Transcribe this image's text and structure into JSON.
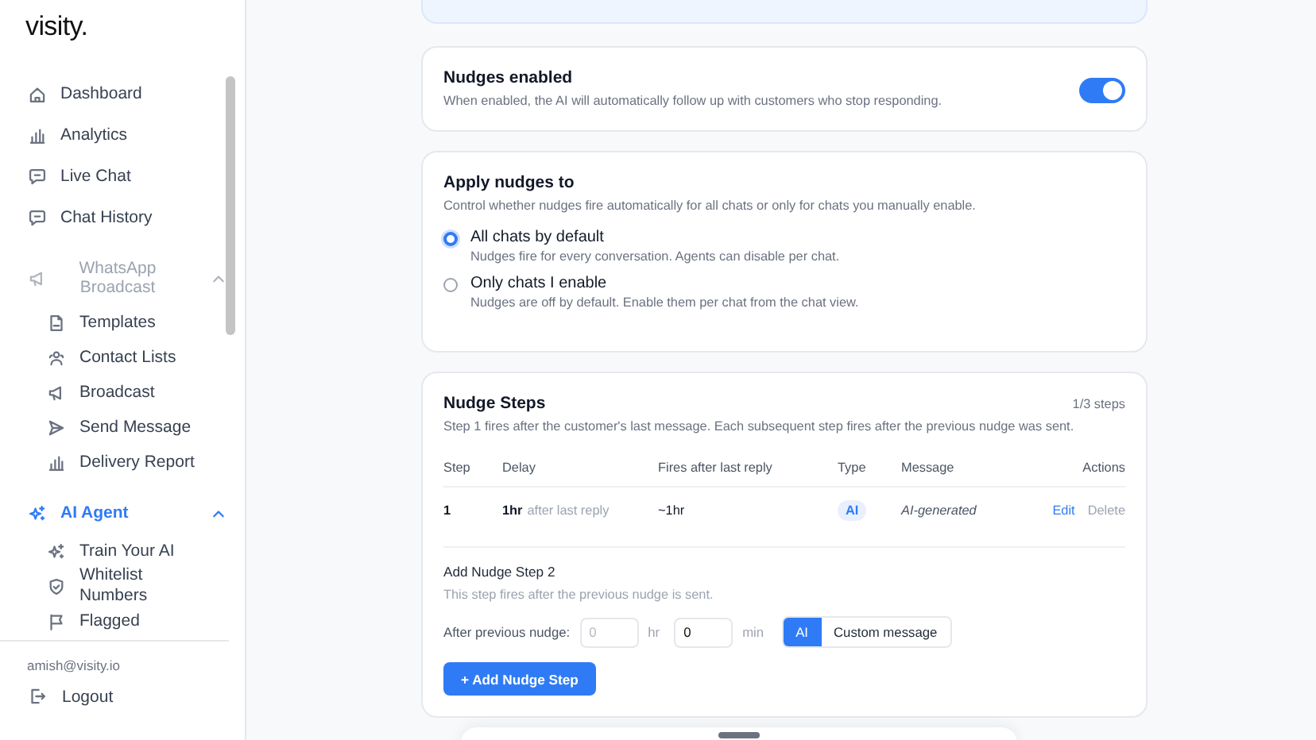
{
  "sidebar": {
    "logo": "visity.",
    "items": [
      {
        "label": "Dashboard",
        "kind": "link",
        "selected": false
      },
      {
        "label": "Analytics",
        "kind": "link",
        "selected": false
      },
      {
        "label": "Live Chat",
        "kind": "link",
        "selected": false
      },
      {
        "label": "Chat History",
        "kind": "link",
        "selected": false
      },
      {
        "label": "WhatsApp Broadcast",
        "kind": "group",
        "selected": false,
        "disabled": true,
        "expanded": true,
        "children": [
          {
            "label": "Templates"
          },
          {
            "label": "Contact Lists"
          },
          {
            "label": "Broadcast"
          },
          {
            "label": "Send Message"
          },
          {
            "label": "Delivery Report"
          }
        ]
      },
      {
        "label": "AI Agent",
        "kind": "group",
        "selected": true,
        "disabled": false,
        "expanded": true,
        "children": [
          {
            "label": "Train Your AI"
          },
          {
            "label": "Whitelist Numbers"
          },
          {
            "label": "Flagged"
          }
        ]
      }
    ],
    "user_email": "amish@visity.io",
    "logout": "Logout"
  },
  "nudges_enabled": {
    "title": "Nudges enabled",
    "description": "When enabled, the AI will automatically follow up with customers who stop responding.",
    "on": true
  },
  "apply_to": {
    "title": "Apply nudges to",
    "description": "Control whether nudges fire automatically for all chats or only for chats you manually enable.",
    "options": [
      {
        "label": "All chats by default",
        "description": "Nudges fire for every conversation. Agents can disable per chat.",
        "selected": true
      },
      {
        "label": "Only chats I enable",
        "description": "Nudges are off by default. Enable them per chat from the chat view.",
        "selected": false
      }
    ]
  },
  "steps": {
    "title": "Nudge Steps",
    "count": "1/3 steps",
    "description": "Step 1 fires after the customer's last message. Each subsequent step fires after the previous nudge was sent.",
    "columns": [
      "Step",
      "Delay",
      "Fires after last reply",
      "Type",
      "Message",
      "Actions"
    ],
    "rows": [
      {
        "step": "1",
        "delay": "1hr",
        "delay_note": "after last reply",
        "fires": "~1hr",
        "type": "AI",
        "message": "AI-generated",
        "actions": [
          "Edit",
          "Delete"
        ]
      }
    ],
    "add": {
      "title": "Add Nudge Step 2",
      "description": "This step fires after the previous nudge is sent.",
      "label": "After previous nudge:",
      "hours": {
        "placeholder": "0",
        "unit": "hr"
      },
      "minutes": {
        "value": "0",
        "unit": "min"
      },
      "types": [
        {
          "label": "AI",
          "selected": true
        },
        {
          "label": "Custom message",
          "selected": false
        }
      ],
      "button": "+ Add Nudge Step"
    }
  }
}
